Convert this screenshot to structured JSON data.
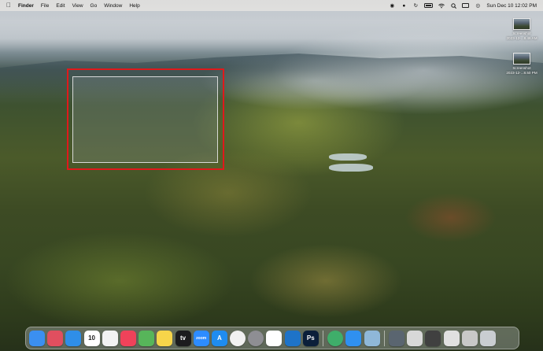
{
  "menubar": {
    "apple_icon": "apple-logo-icon",
    "app_name": "Finder",
    "menus": [
      "File",
      "Edit",
      "View",
      "Go",
      "Window",
      "Help"
    ],
    "datetime": "Sun Dec 10  12:02 PM"
  },
  "desktop_items": [
    {
      "name": "Screenshot",
      "subtitle": "2023-12-...8.46 AM"
    },
    {
      "name": "Screenshot",
      "subtitle": "2023-12-...8.50 PM"
    }
  ],
  "dock": {
    "apps": [
      {
        "icon": "finder-icon",
        "color": "#3b8ff0"
      },
      {
        "icon": "launchpad-icon",
        "color": "#e04f5f"
      },
      {
        "icon": "safari-icon",
        "color": "#2f8ee8"
      },
      {
        "icon": "calendar-icon",
        "color": "#ffffff",
        "label": "10"
      },
      {
        "icon": "reminders-icon",
        "color": "#f2f2f2"
      },
      {
        "icon": "music-icon",
        "color": "#f0425a"
      },
      {
        "icon": "maps-icon",
        "color": "#57b55a"
      },
      {
        "icon": "notes-icon",
        "color": "#f7d54a"
      },
      {
        "icon": "apple-tv-icon",
        "color": "#1c1c1e",
        "label": "tv"
      },
      {
        "icon": "zoom-icon",
        "color": "#2d8cff",
        "label": "zoom"
      },
      {
        "icon": "app-store-icon",
        "color": "#1f8cf0",
        "label": "A"
      },
      {
        "icon": "chrome-icon",
        "color": "#f1f1f1"
      },
      {
        "icon": "system-settings-icon",
        "color": "#8e8e93"
      },
      {
        "icon": "slack-icon",
        "color": "#ffffff"
      },
      {
        "icon": "vscode-icon",
        "color": "#1e73c8"
      },
      {
        "icon": "photoshop-icon",
        "color": "#0b1f3a",
        "label": "Ps"
      },
      {
        "icon": "sep"
      },
      {
        "icon": "whatsapp-like-icon",
        "color": "#3fae6a"
      },
      {
        "icon": "mail-icon",
        "color": "#2f90f0"
      },
      {
        "icon": "preview-icon",
        "color": "#8fb7d8"
      },
      {
        "icon": "sep"
      },
      {
        "icon": "recent-window-icon",
        "color": "#5a6570"
      },
      {
        "icon": "recent-window-icon",
        "color": "#d8d8d8"
      },
      {
        "icon": "recent-window-icon",
        "color": "#404040"
      },
      {
        "icon": "recent-window-icon",
        "color": "#e0e0e0"
      },
      {
        "icon": "recent-window-icon",
        "color": "#c8c8c8"
      },
      {
        "icon": "trash-icon",
        "color": "#c9cdd1"
      }
    ]
  }
}
